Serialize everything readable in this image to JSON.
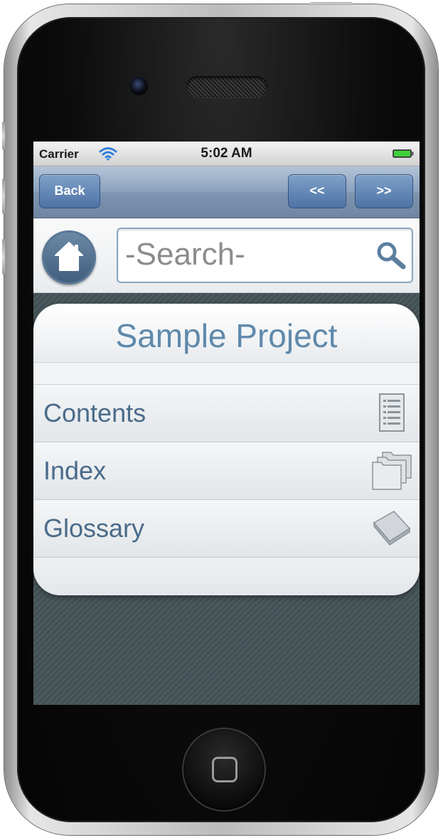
{
  "status_bar": {
    "carrier": "Carrier",
    "time": "5:02 AM"
  },
  "nav": {
    "back_label": "Back",
    "prev_label": "<<",
    "next_label": ">>"
  },
  "search": {
    "placeholder": "-Search-"
  },
  "panel": {
    "title": "Sample Project",
    "items": [
      {
        "label": "Contents",
        "icon": "list-document-icon"
      },
      {
        "label": "Index",
        "icon": "stacked-folders-icon"
      },
      {
        "label": "Glossary",
        "icon": "book-icon"
      }
    ]
  },
  "colors": {
    "nav_bar": "#8aa1bd",
    "button": "#5a7fb0",
    "title_text": "#5f89ab",
    "item_text": "#4a6b8a",
    "screen_background": "#475457"
  }
}
